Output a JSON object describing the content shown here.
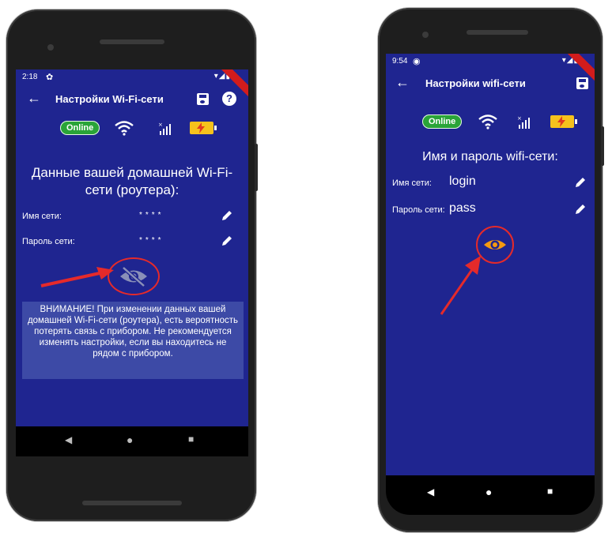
{
  "left": {
    "time": "2:18",
    "title": "Настройки Wi-Fi-сети",
    "online": "Online",
    "heading": "Данные вашей домашней Wi-Fi-сети (роутера):",
    "ssid_label": "Имя сети:",
    "ssid_value": "****",
    "pass_label": "Пароль сети:",
    "pass_value": "****",
    "warning": "ВНИМАНИЕ! При изменении данных вашей домашней Wi-Fi-сети (роутера), есть вероятность потерять связь с прибором. Не рекомендуется изменять настройки, если вы находитесь не рядом с прибором."
  },
  "right": {
    "time": "9:54",
    "title": "Настройки wifi-сети",
    "online": "Online",
    "heading": "Имя и пароль wifi-сети:",
    "ssid_label": "Имя сети:",
    "ssid_value": "login",
    "pass_label": "Пароль сети:",
    "pass_value": "pass"
  },
  "icons": {
    "back": "arrow-left-icon",
    "save": "save-icon",
    "help": "help-icon",
    "wifi": "wifi-icon",
    "signal": "signal-icon",
    "battery": "battery-charging-icon",
    "edit": "pencil-icon",
    "eye_hidden": "eye-off-icon",
    "eye_visible": "eye-icon"
  },
  "colors": {
    "screen_bg": "#1f2590",
    "online_bg": "#2aa438",
    "battery": "#f6c21c",
    "highlight": "#e52a2a",
    "eye_visible": "#f59a12",
    "eye_hidden": "#8a90b8"
  }
}
